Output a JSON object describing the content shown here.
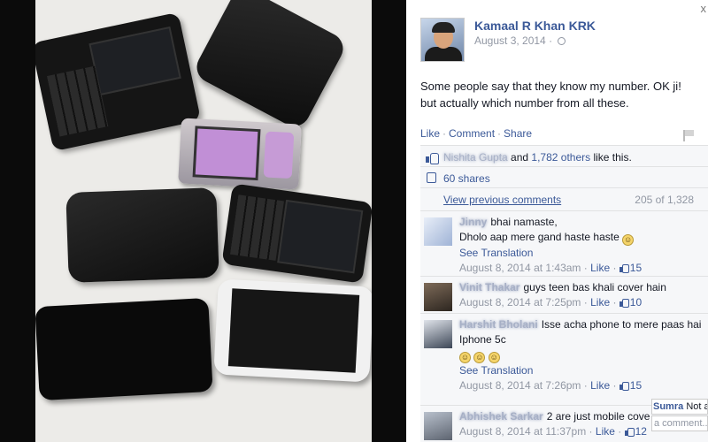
{
  "post": {
    "author": "Kamaal R Khan KRK",
    "date": "August 3, 2014",
    "date_sep": "·",
    "text": "Some people say that they know my number. OK ji! but actually which number from all these."
  },
  "actions": {
    "like": "Like",
    "comment": "Comment",
    "share": "Share",
    "sep": "·"
  },
  "likes": {
    "name": "Nishita Gupta",
    "and": " and ",
    "others": "1,782 others",
    "suffix": " like this."
  },
  "shares": {
    "label": "60 shares"
  },
  "previous": {
    "label": "View previous comments",
    "count": "205 of 1,328"
  },
  "comments": [
    {
      "name": "Jinny",
      "text": "bhai namaste,",
      "text2": "Dholo aap mere gand haste haste",
      "emoji": "smile",
      "translation": "See Translation",
      "time": "August 8, 2014 at 1:43am",
      "like": "Like",
      "likes": "15"
    },
    {
      "name": "Vinit Thakar",
      "text": "guys teen bas khali cover hain",
      "time": "August 8, 2014 at 7:25pm",
      "like": "Like",
      "likes": "10"
    },
    {
      "name": "Harshit Bholani",
      "text": "Isse acha phone to mere paas hai",
      "text2": "Iphone 5c",
      "emoji": "laugh-x3",
      "translation": "See Translation",
      "time": "August 8, 2014 at 7:26pm",
      "like": "Like",
      "likes": "15"
    },
    {
      "name": "Abhishek Sarkar",
      "text": "2 are just mobile cove",
      "time": "August 8, 2014 at 11:37pm",
      "like": "Like",
      "likes": "12"
    }
  ],
  "chat_popup": {
    "name": "Sumra",
    "text": "Not a"
  },
  "write_popup": {
    "placeholder": "a comment..."
  },
  "close_glyph": "x",
  "colors": {
    "link": "#3b5998",
    "meta": "#9197a3",
    "background": "#f6f7f9"
  }
}
